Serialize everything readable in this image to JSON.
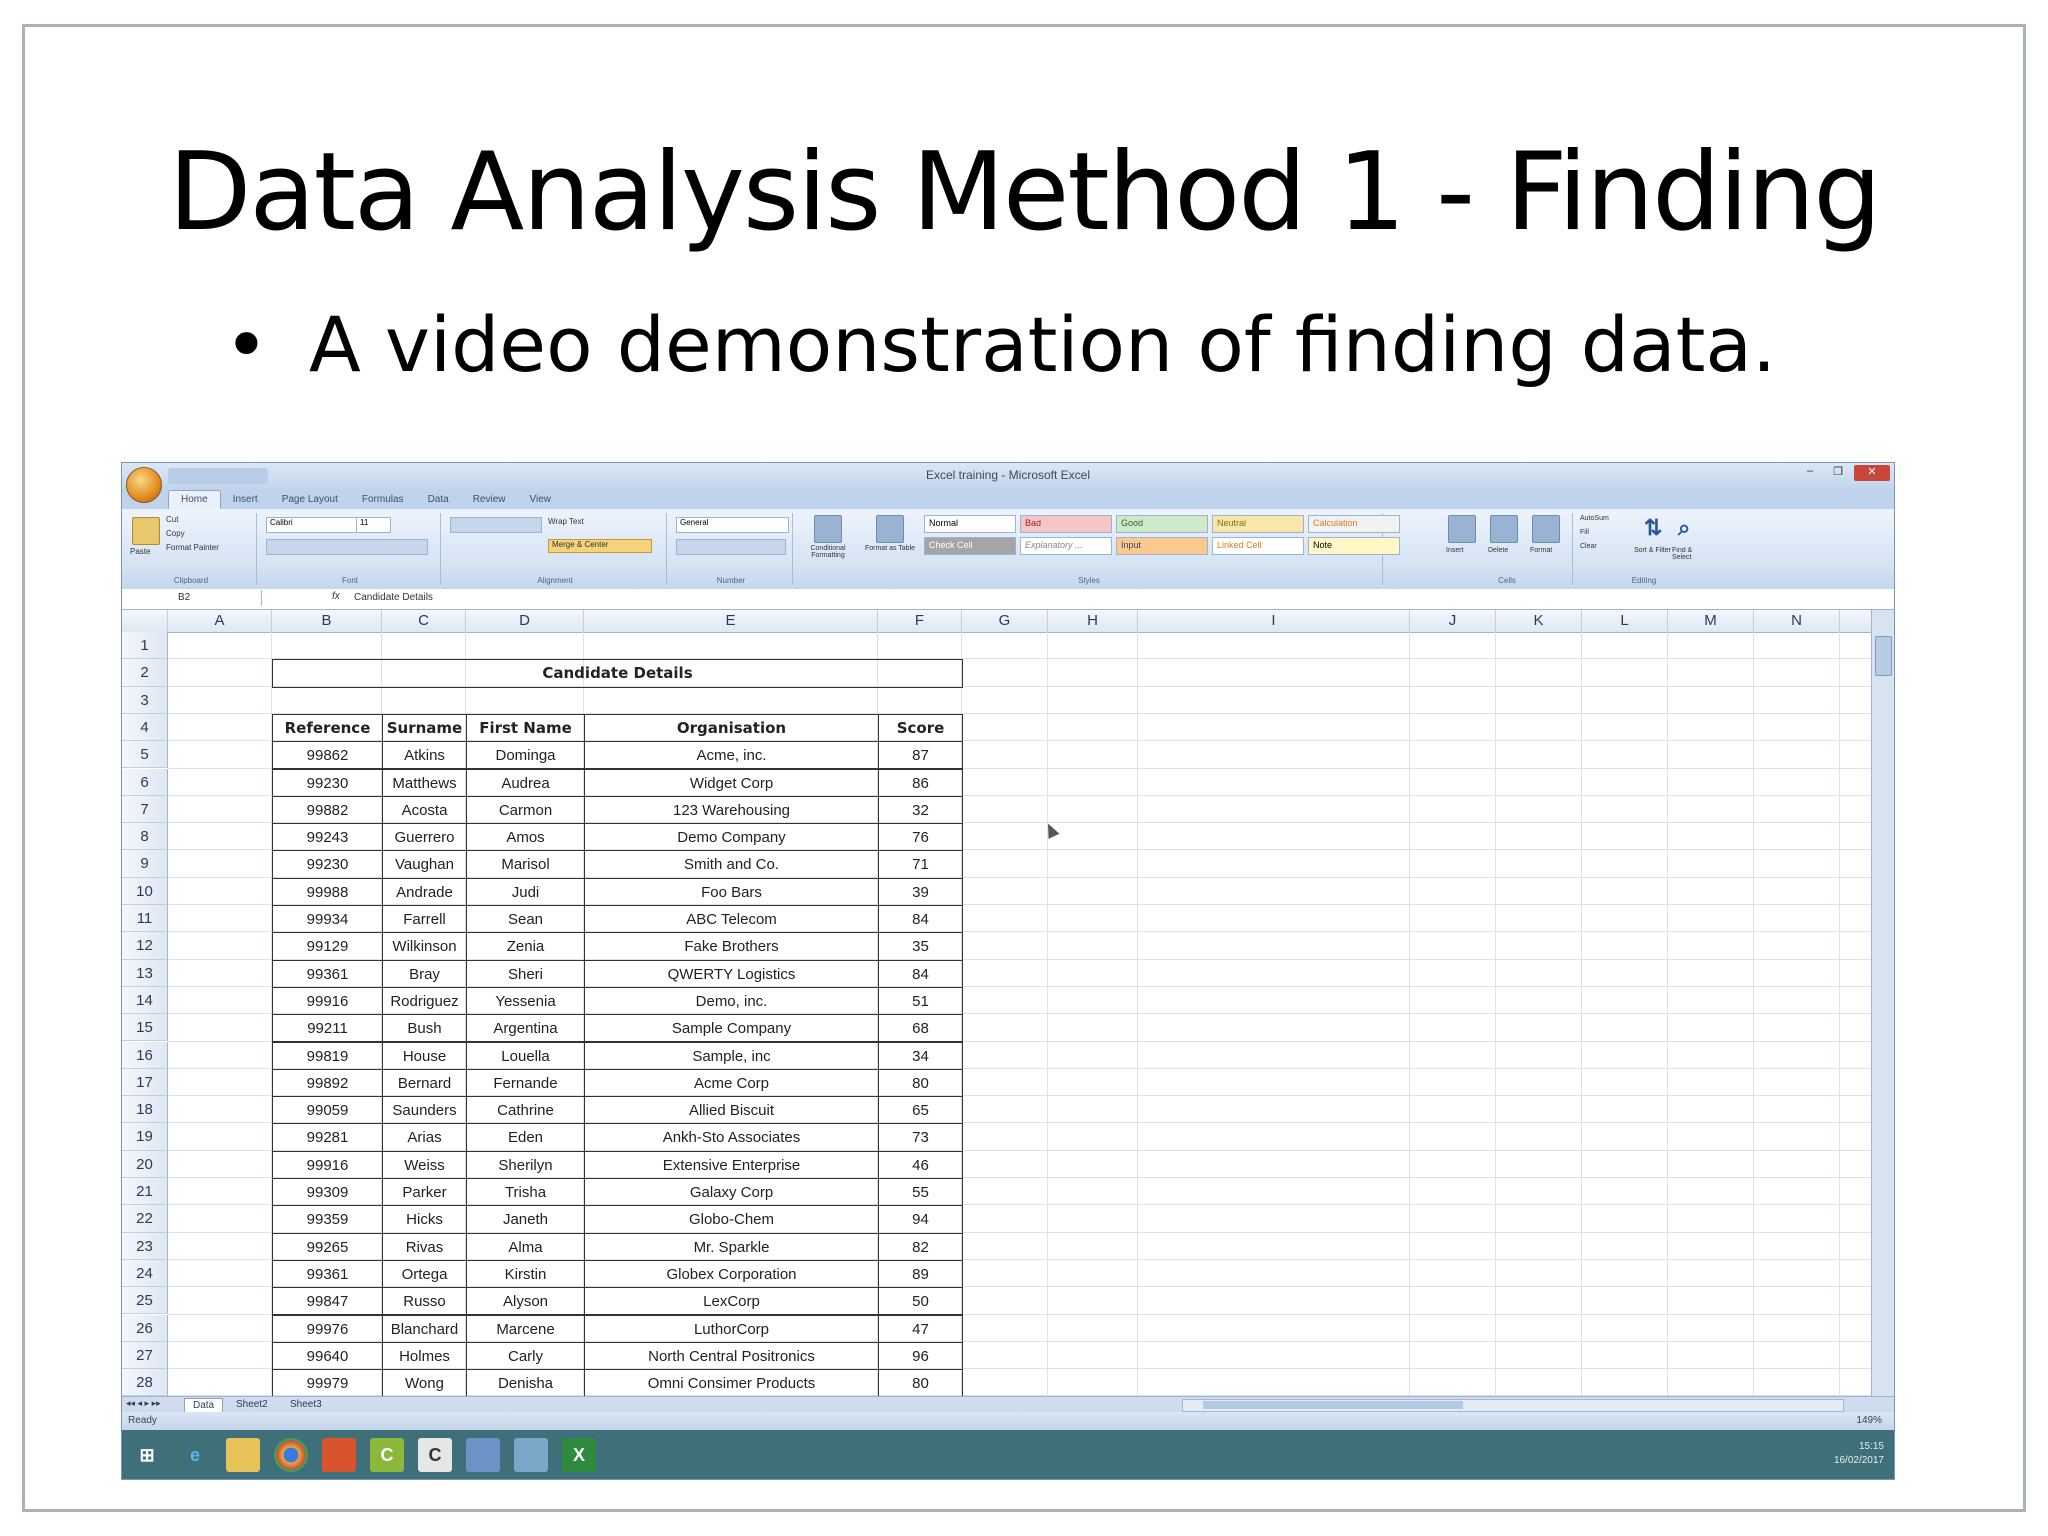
{
  "slide": {
    "title": "Data Analysis Method 1 - Finding",
    "bullet": "A video demonstration of finding data."
  },
  "excel": {
    "window_title": "Excel training - Microsoft Excel",
    "tabs": [
      "Home",
      "Insert",
      "Page Layout",
      "Formulas",
      "Data",
      "Review",
      "View"
    ],
    "ribbon": {
      "clipboard": {
        "paste": "Paste",
        "cut": "Cut",
        "copy": "Copy",
        "format_painter": "Format Painter",
        "label": "Clipboard"
      },
      "font": {
        "name": "Calibri",
        "size": "11",
        "label": "Font"
      },
      "alignment": {
        "wrap_text": "Wrap Text",
        "merge_center": "Merge & Center",
        "label": "Alignment"
      },
      "number": {
        "format": "General",
        "label": "Number"
      },
      "styles": {
        "conditional_formatting": "Conditional Formatting",
        "format_as_table": "Format as Table",
        "normal": "Normal",
        "bad": "Bad",
        "good": "Good",
        "neutral": "Neutral",
        "calculation": "Calculation",
        "check_cell": "Check Cell",
        "explanatory": "Explanatory ...",
        "input": "Input",
        "linked_cell": "Linked Cell",
        "note": "Note",
        "label": "Styles"
      },
      "cells": {
        "insert": "Insert",
        "delete": "Delete",
        "format": "Format",
        "label": "Cells"
      },
      "editing": {
        "autosum": "AutoSum",
        "fill": "Fill",
        "clear": "Clear",
        "sort_filter": "Sort & Filter",
        "find_select": "Find & Select",
        "label": "Editing"
      }
    },
    "name_box": "B2",
    "fx": "fx",
    "formula": "Candidate Details",
    "columns": [
      "A",
      "B",
      "C",
      "D",
      "E",
      "F",
      "G",
      "H",
      "I",
      "J",
      "K",
      "L",
      "M",
      "N"
    ],
    "rows": [
      "1",
      "2",
      "3",
      "4",
      "5",
      "6",
      "7",
      "8",
      "9",
      "10",
      "11",
      "12",
      "13",
      "14",
      "15",
      "16",
      "17",
      "18",
      "19",
      "20",
      "21",
      "22",
      "23",
      "24",
      "25",
      "26",
      "27",
      "28"
    ],
    "table_title": "Candidate Details",
    "headers": [
      "Reference",
      "Surname",
      "First Name",
      "Organisation",
      "Score"
    ],
    "data": [
      [
        "99862",
        "Atkins",
        "Dominga",
        "Acme, inc.",
        "87"
      ],
      [
        "99230",
        "Matthews",
        "Audrea",
        "Widget Corp",
        "86"
      ],
      [
        "99882",
        "Acosta",
        "Carmon",
        "123 Warehousing",
        "32"
      ],
      [
        "99243",
        "Guerrero",
        "Amos",
        "Demo Company",
        "76"
      ],
      [
        "99230",
        "Vaughan",
        "Marisol",
        "Smith and Co.",
        "71"
      ],
      [
        "99988",
        "Andrade",
        "Judi",
        "Foo Bars",
        "39"
      ],
      [
        "99934",
        "Farrell",
        "Sean",
        "ABC Telecom",
        "84"
      ],
      [
        "99129",
        "Wilkinson",
        "Zenia",
        "Fake Brothers",
        "35"
      ],
      [
        "99361",
        "Bray",
        "Sheri",
        "QWERTY Logistics",
        "84"
      ],
      [
        "99916",
        "Rodriguez",
        "Yessenia",
        "Demo, inc.",
        "51"
      ],
      [
        "99211",
        "Bush",
        "Argentina",
        "Sample Company",
        "68"
      ],
      [
        "99819",
        "House",
        "Louella",
        "Sample, inc",
        "34"
      ],
      [
        "99892",
        "Bernard",
        "Fernande",
        "Acme Corp",
        "80"
      ],
      [
        "99059",
        "Saunders",
        "Cathrine",
        "Allied Biscuit",
        "65"
      ],
      [
        "99281",
        "Arias",
        "Eden",
        "Ankh-Sto Associates",
        "73"
      ],
      [
        "99916",
        "Weiss",
        "Sherilyn",
        "Extensive Enterprise",
        "46"
      ],
      [
        "99309",
        "Parker",
        "Trisha",
        "Galaxy Corp",
        "55"
      ],
      [
        "99359",
        "Hicks",
        "Janeth",
        "Globo-Chem",
        "94"
      ],
      [
        "99265",
        "Rivas",
        "Alma",
        "Mr. Sparkle",
        "82"
      ],
      [
        "99361",
        "Ortega",
        "Kirstin",
        "Globex Corporation",
        "89"
      ],
      [
        "99847",
        "Russo",
        "Alyson",
        "LexCorp",
        "50"
      ],
      [
        "99976",
        "Blanchard",
        "Marcene",
        "LuthorCorp",
        "47"
      ],
      [
        "99640",
        "Holmes",
        "Carly",
        "North Central Positronics",
        "96"
      ],
      [
        "99979",
        "Wong",
        "Denisha",
        "Omni Consimer Products",
        "80"
      ]
    ],
    "sheet_tabs": [
      "Data",
      "Sheet2",
      "Sheet3"
    ],
    "status": "Ready",
    "zoom": "149%",
    "tray": {
      "time": "15:15",
      "date": "16/02/2017"
    }
  },
  "colors": {
    "frame": "#a9b1bd",
    "ribbon": "#d5e3f4",
    "taskbar": "#3f6f78"
  }
}
